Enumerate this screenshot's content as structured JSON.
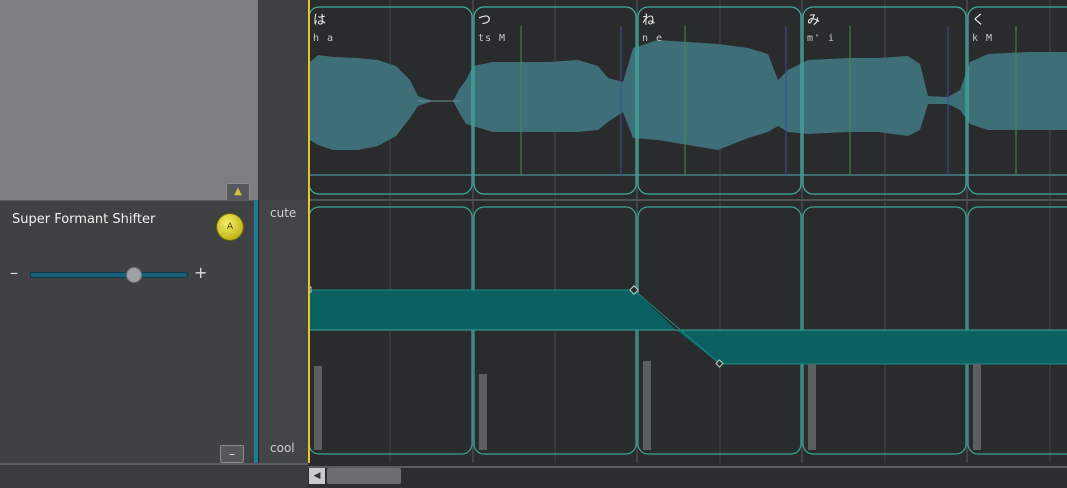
{
  "parameter": {
    "name": "Super Formant Shifter",
    "auto_button_label": "A",
    "minus_label": "–",
    "plus_label": "+",
    "slider_value_fraction": 0.66,
    "scale_top_label": "cute",
    "scale_bottom_label": "cool"
  },
  "buttons": {
    "collapse_up": "▲",
    "collapse_minus": "–",
    "scroll_left": "◀"
  },
  "notes": [
    {
      "lyric": "は",
      "phonemes": "h a"
    },
    {
      "lyric": "つ",
      "phonemes": "ts M"
    },
    {
      "lyric": "ね",
      "phonemes": "n e"
    },
    {
      "lyric": "み",
      "phonemes": "m' i"
    },
    {
      "lyric": "く",
      "phonemes": "k M"
    }
  ],
  "colors": {
    "note_outline": "#3fb0a0",
    "waveform": "#3e6e78",
    "parameter_fill": "#0b6161",
    "playhead": "#e6c62a",
    "accent": "#1f7a9a"
  }
}
